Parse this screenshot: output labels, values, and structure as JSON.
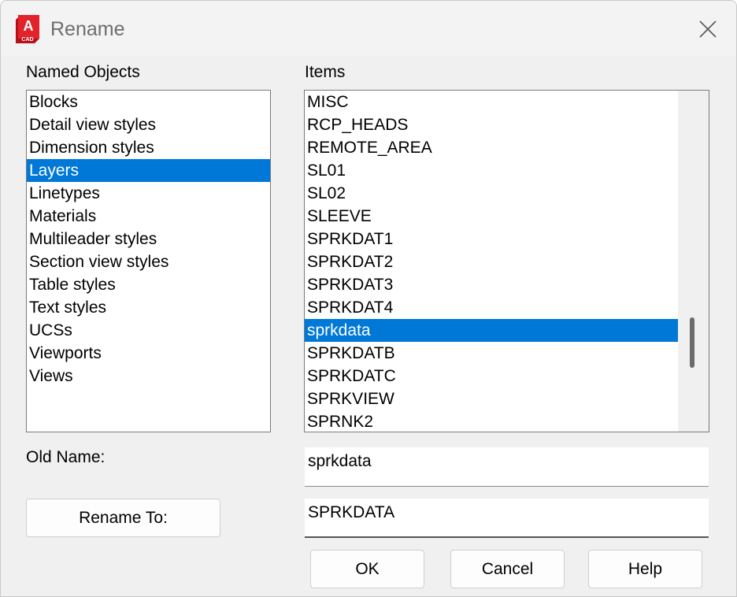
{
  "window": {
    "title": "Rename",
    "app_icon": {
      "name": "autocad-icon",
      "letter": "A",
      "sub": "CAD",
      "color": "#d9262e"
    }
  },
  "named_objects": {
    "label": "Named Objects",
    "items": [
      {
        "label": "Blocks",
        "selected": false
      },
      {
        "label": "Detail view styles",
        "selected": false
      },
      {
        "label": "Dimension styles",
        "selected": false
      },
      {
        "label": "Layers",
        "selected": true
      },
      {
        "label": "Linetypes",
        "selected": false
      },
      {
        "label": "Materials",
        "selected": false
      },
      {
        "label": "Multileader styles",
        "selected": false
      },
      {
        "label": "Section view styles",
        "selected": false
      },
      {
        "label": "Table styles",
        "selected": false
      },
      {
        "label": "Text styles",
        "selected": false
      },
      {
        "label": "UCSs",
        "selected": false
      },
      {
        "label": "Viewports",
        "selected": false
      },
      {
        "label": "Views",
        "selected": false
      }
    ]
  },
  "items": {
    "label": "Items",
    "items": [
      {
        "label": "MISC",
        "selected": false
      },
      {
        "label": "RCP_HEADS",
        "selected": false
      },
      {
        "label": "REMOTE_AREA",
        "selected": false
      },
      {
        "label": "SL01",
        "selected": false
      },
      {
        "label": "SL02",
        "selected": false
      },
      {
        "label": "SLEEVE",
        "selected": false
      },
      {
        "label": "SPRKDAT1",
        "selected": false
      },
      {
        "label": "SPRKDAT2",
        "selected": false
      },
      {
        "label": "SPRKDAT3",
        "selected": false
      },
      {
        "label": "SPRKDAT4",
        "selected": false
      },
      {
        "label": "sprkdata",
        "selected": true
      },
      {
        "label": "SPRKDATB",
        "selected": false
      },
      {
        "label": "SPRKDATC",
        "selected": false
      },
      {
        "label": "SPRKVIEW",
        "selected": false
      },
      {
        "label": "SPRNK2",
        "selected": false
      }
    ],
    "scroll_position": 0.78
  },
  "old_name": {
    "label": "Old Name:",
    "value": "sprkdata"
  },
  "rename_to": {
    "button_label": "Rename To:",
    "value": "SPRKDATA"
  },
  "buttons": {
    "ok": "OK",
    "cancel": "Cancel",
    "help": "Help"
  },
  "colors": {
    "selection": "#0078d7",
    "background": "#f0f0f0"
  }
}
